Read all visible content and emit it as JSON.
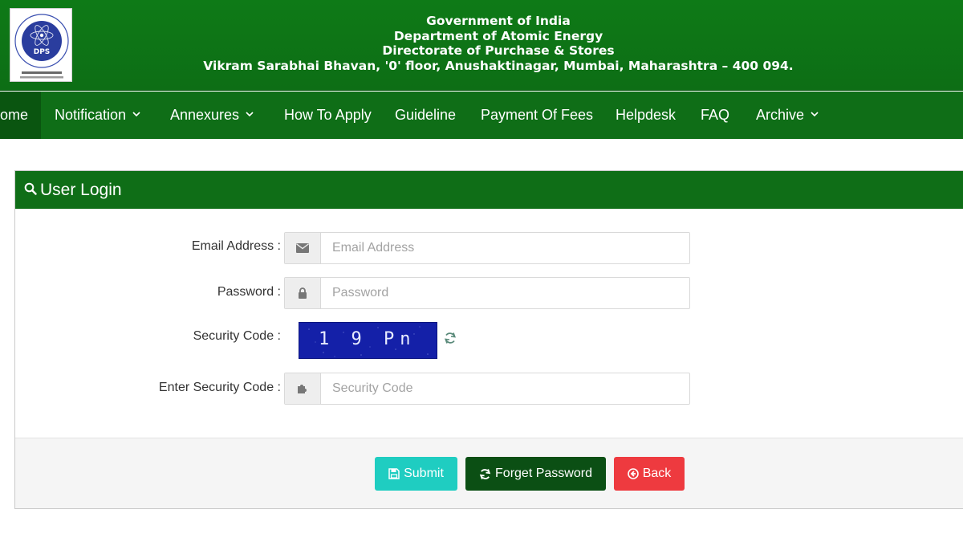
{
  "header": {
    "logo_text": "DPS",
    "line1": "Government of India",
    "line2": "Department of Atomic Energy",
    "line3": "Directorate of Purchase & Stores",
    "address": "Vikram Sarabhai Bhavan, '0' floor, Anushaktinagar, Mumbai, Maharashtra – 400 094."
  },
  "nav": {
    "items": [
      {
        "label": "ome"
      },
      {
        "label": "Notification"
      },
      {
        "label": "Annexures"
      },
      {
        "label": "How To Apply"
      },
      {
        "label": "Guideline"
      },
      {
        "label": "Payment Of Fees"
      },
      {
        "label": "Helpdesk"
      },
      {
        "label": "FAQ"
      },
      {
        "label": "Archive"
      }
    ]
  },
  "login": {
    "title": "User Login",
    "email_label": "Email Address :",
    "email_placeholder": "Email Address",
    "password_label": "Password :",
    "password_placeholder": "Password",
    "security_label": "Security Code :",
    "captcha_text": "1 9 Pn",
    "enter_code_label": "Enter Security Code :",
    "code_placeholder": "Security Code"
  },
  "buttons": {
    "submit": "Submit",
    "forget": "Forget Password",
    "back": "Back"
  },
  "colors": {
    "header_green": "#0e7a17",
    "nav_green": "#0f6e17",
    "submit": "#1fcdc1",
    "forget": "#0b4f14",
    "back": "#ee3a3f",
    "captcha_bg": "#1420a8"
  }
}
